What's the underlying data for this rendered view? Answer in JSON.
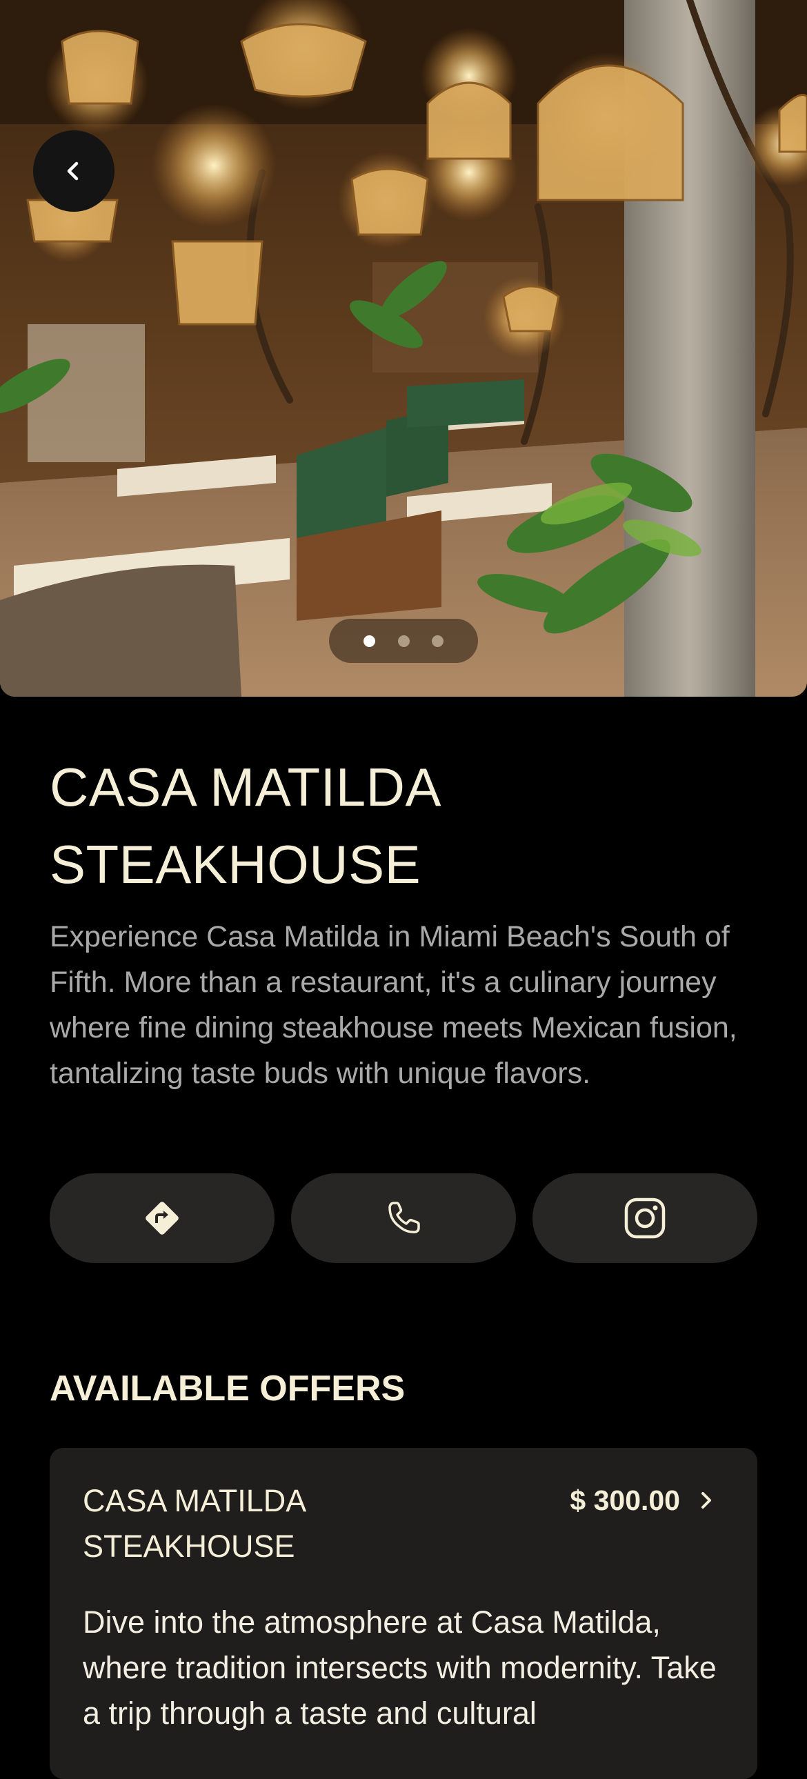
{
  "colors": {
    "background": "#000000",
    "title_text": "#f5efd8",
    "body_text": "#a9a9a9",
    "button_bg": "#272624",
    "card_bg": "#1f1e1d",
    "accent_cream": "#f5efd8"
  },
  "hero": {
    "back_icon": "chevron-left-icon",
    "carousel": {
      "count": 3,
      "active_index": 0
    }
  },
  "venue": {
    "title_line1": "CASA MATILDA",
    "title_line2": "STEAKHOUSE",
    "description": "Experience Casa Matilda in Miami Beach's South of Fifth. More than a restaurant, it's a culinary journey where fine dining steakhouse meets Mexican fusion, tantalizing taste buds with unique flavors."
  },
  "actions": [
    {
      "name": "directions",
      "icon": "directions-icon"
    },
    {
      "name": "call",
      "icon": "phone-icon"
    },
    {
      "name": "instagram",
      "icon": "instagram-icon"
    }
  ],
  "offers": {
    "section_title": "AVAILABLE OFFERS",
    "items": [
      {
        "name_line1": "CASA MATILDA",
        "name_line2": "STEAKHOUSE",
        "price": "$ 300.00",
        "description": "Dive into the atmosphere at Casa Matilda, where tradition intersects with modernity. Take a trip through a taste and cultural"
      }
    ]
  }
}
